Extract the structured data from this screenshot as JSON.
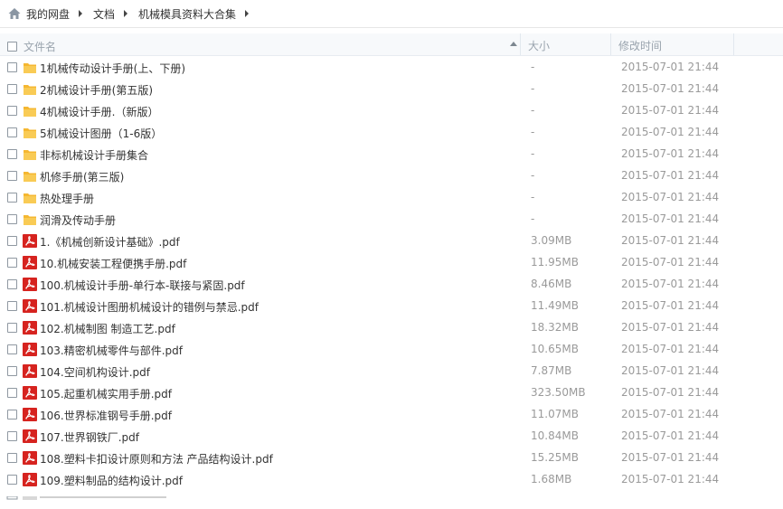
{
  "breadcrumb": {
    "home_icon": "home-icon",
    "items": [
      "我的网盘",
      "文档",
      "机械模具资料大合集"
    ]
  },
  "columns": {
    "name": "文件名",
    "size": "大小",
    "modified": "修改时间"
  },
  "colors": {
    "folder": "#f7c244",
    "pdf": "#d6231f",
    "meta_text": "#9a9a9a",
    "header_bg": "#f7f9fb"
  },
  "files": [
    {
      "name": "1机械传动设计手册(上、下册)",
      "size": "-",
      "modified": "2015-07-01 21:44",
      "icon": "folder-icon"
    },
    {
      "name": "2机械设计手册(第五版)",
      "size": "-",
      "modified": "2015-07-01 21:44",
      "icon": "folder-icon"
    },
    {
      "name": "4机械设计手册.（新版）",
      "size": "-",
      "modified": "2015-07-01 21:44",
      "icon": "folder-icon"
    },
    {
      "name": "5机械设计图册（1-6版）",
      "size": "-",
      "modified": "2015-07-01 21:44",
      "icon": "folder-icon"
    },
    {
      "name": "非标机械设计手册集合",
      "size": "-",
      "modified": "2015-07-01 21:44",
      "icon": "folder-icon"
    },
    {
      "name": "机修手册(第三版)",
      "size": "-",
      "modified": "2015-07-01 21:44",
      "icon": "folder-icon"
    },
    {
      "name": "热处理手册",
      "size": "-",
      "modified": "2015-07-01 21:44",
      "icon": "folder-icon"
    },
    {
      "name": "润滑及传动手册",
      "size": "-",
      "modified": "2015-07-01 21:44",
      "icon": "folder-icon"
    },
    {
      "name": "1.《机械创新设计基础》.pdf",
      "size": "3.09MB",
      "modified": "2015-07-01 21:44",
      "icon": "pdf-icon"
    },
    {
      "name": "10.机械安装工程便携手册.pdf",
      "size": "11.95MB",
      "modified": "2015-07-01 21:44",
      "icon": "pdf-icon"
    },
    {
      "name": "100.机械设计手册-单行本-联接与紧固.pdf",
      "size": "8.46MB",
      "modified": "2015-07-01 21:44",
      "icon": "pdf-icon"
    },
    {
      "name": "101.机械设计图册机械设计的错例与禁忌.pdf",
      "size": "11.49MB",
      "modified": "2015-07-01 21:44",
      "icon": "pdf-icon"
    },
    {
      "name": "102.机械制图 制造工艺.pdf",
      "size": "18.32MB",
      "modified": "2015-07-01 21:44",
      "icon": "pdf-icon"
    },
    {
      "name": "103.精密机械零件与部件.pdf",
      "size": "10.65MB",
      "modified": "2015-07-01 21:44",
      "icon": "pdf-icon"
    },
    {
      "name": "104.空间机构设计.pdf",
      "size": "7.87MB",
      "modified": "2015-07-01 21:44",
      "icon": "pdf-icon"
    },
    {
      "name": "105.起重机械实用手册.pdf",
      "size": "323.50MB",
      "modified": "2015-07-01 21:44",
      "icon": "pdf-icon"
    },
    {
      "name": "106.世界标准钢号手册.pdf",
      "size": "11.07MB",
      "modified": "2015-07-01 21:44",
      "icon": "pdf-icon"
    },
    {
      "name": "107.世界钢铁厂.pdf",
      "size": "10.84MB",
      "modified": "2015-07-01 21:44",
      "icon": "pdf-icon"
    },
    {
      "name": "108.塑料卡扣设计原则和方法 产品结构设计.pdf",
      "size": "15.25MB",
      "modified": "2015-07-01 21:44",
      "icon": "pdf-icon"
    },
    {
      "name": "109.塑料制品的结构设计.pdf",
      "size": "1.68MB",
      "modified": "2015-07-01 21:44",
      "icon": "pdf-icon"
    }
  ]
}
